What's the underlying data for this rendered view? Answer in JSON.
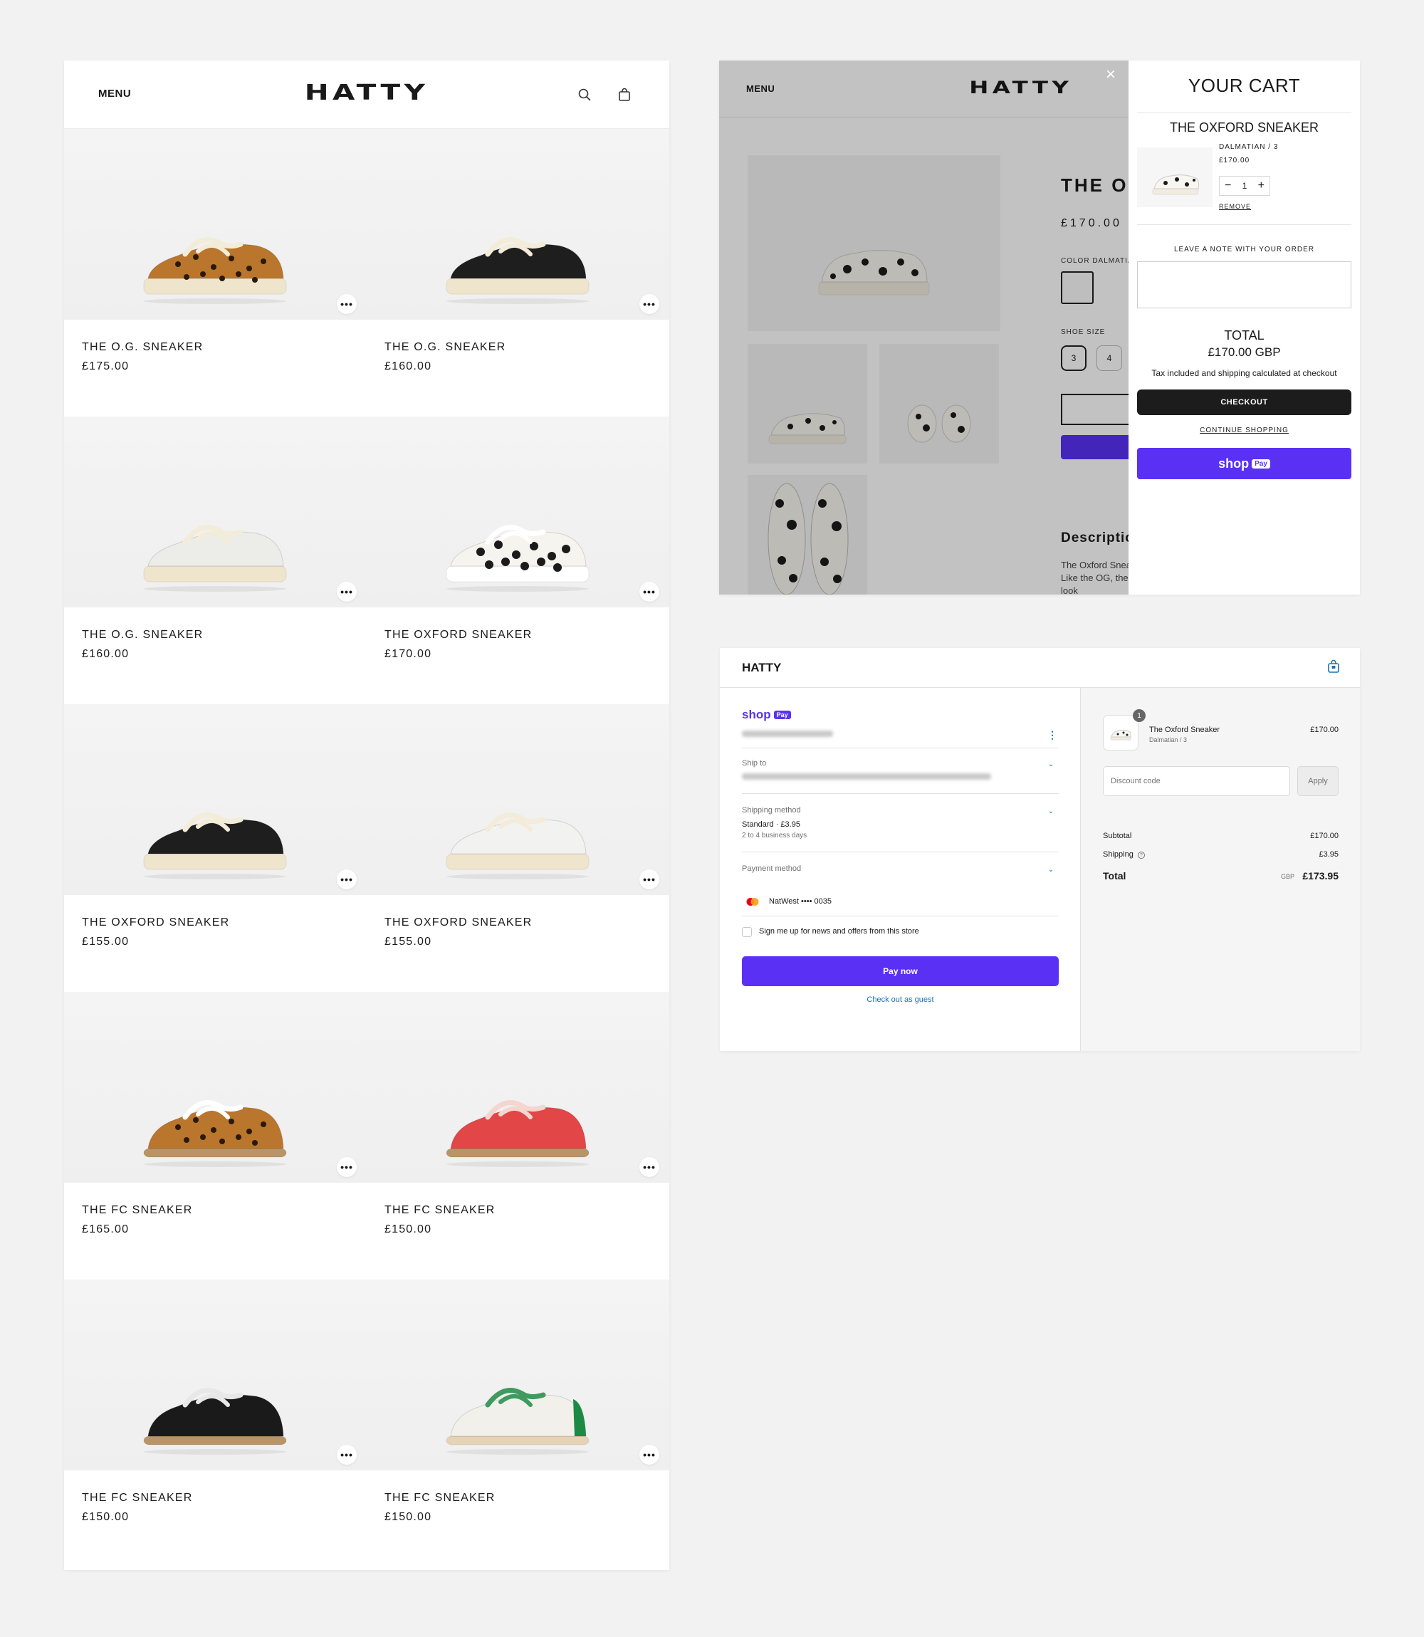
{
  "colors": {
    "page_bg": "#f2f2f2",
    "shop_pay_purple": "#5a31f4",
    "checkout_dark": "#1c1c1c",
    "link_blue": "#1773b0"
  },
  "grid_page": {
    "menu_label": "MENU",
    "brand": "HATTY",
    "icons": [
      "search-icon",
      "cart-icon"
    ],
    "products": [
      {
        "name": "THE O.G. SNEAKER",
        "price": "£175.00",
        "style": "leopard-og"
      },
      {
        "name": "THE O.G. SNEAKER",
        "price": "£160.00",
        "style": "black-og"
      },
      {
        "name": "THE O.G. SNEAKER",
        "price": "£160.00",
        "style": "white-og"
      },
      {
        "name": "THE OXFORD SNEAKER",
        "price": "£170.00",
        "style": "dalmatian-oxford"
      },
      {
        "name": "THE OXFORD SNEAKER",
        "price": "£155.00",
        "style": "black-oxford"
      },
      {
        "name": "THE OXFORD SNEAKER",
        "price": "£155.00",
        "style": "white-oxford"
      },
      {
        "name": "THE FC SNEAKER",
        "price": "£165.00",
        "style": "leopard-fc"
      },
      {
        "name": "THE FC SNEAKER",
        "price": "£150.00",
        "style": "red-fc"
      },
      {
        "name": "THE FC SNEAKER",
        "price": "£150.00",
        "style": "black-fc"
      },
      {
        "name": "THE FC SNEAKER",
        "price": "£150.00",
        "style": "green-fc"
      }
    ],
    "more_label": "•••"
  },
  "product_page": {
    "menu_label": "MENU",
    "brand": "HATTY",
    "title": "THE OXFORD SNEAKER",
    "price": "£170.00",
    "color_label": "COLOR DALMATIAN",
    "size_label": "SHOE SIZE",
    "sizes": [
      "3",
      "4"
    ],
    "description_heading": "Description",
    "description_lines": [
      "The Oxford Sneaker",
      "Like the OG, the",
      "look"
    ],
    "close_icon": "×"
  },
  "cart": {
    "title": "YOUR CART",
    "item_name": "THE OXFORD SNEAKER",
    "variant": "DALMATIAN / 3",
    "item_price": "£170.00",
    "qty_minus": "−",
    "qty": "1",
    "qty_plus": "+",
    "remove_label": "REMOVE",
    "note_label": "LEAVE A NOTE WITH YOUR ORDER",
    "total_label": "TOTAL",
    "total_value": "£170.00 GBP",
    "tax_note": "Tax included and shipping calculated at checkout",
    "checkout_label": "CHECKOUT",
    "continue_label": "CONTINUE SHOPPING",
    "shop_pay": {
      "word": "shop",
      "badge": "Pay"
    }
  },
  "checkout": {
    "brand": "HATTY",
    "shop_pay": {
      "word": "shop",
      "badge": "Pay"
    },
    "more_icon": "⋮",
    "ship_to_label": "Ship to",
    "shipping_method_label": "Shipping method",
    "shipping_method_value": "Standard · £3.95",
    "shipping_method_sub": "2 to 4 business days",
    "payment_method_label": "Payment method",
    "payment_card": "NatWest •••• 0035",
    "newsletter_label": "Sign me up for news and offers from this store",
    "newsletter_checked": false,
    "pay_now_label": "Pay now",
    "guest_label": "Check out as guest",
    "summary": {
      "item_qty": "1",
      "item_name": "The Oxford Sneaker",
      "item_variant": "Dalmatian / 3",
      "item_price": "£170.00",
      "discount_placeholder": "Discount code",
      "apply_label": "Apply",
      "subtotal_label": "Subtotal",
      "subtotal_value": "£170.00",
      "shipping_label": "Shipping",
      "shipping_value": "£3.95",
      "total_label": "Total",
      "total_currency": "GBP",
      "total_value": "£173.95"
    }
  }
}
